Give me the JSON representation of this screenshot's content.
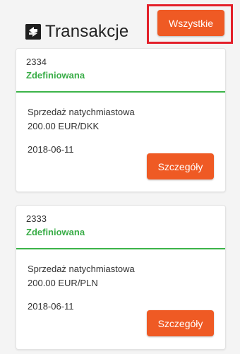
{
  "header": {
    "icon": "transactions-icon",
    "title": "Transakcje",
    "all_button": "Wszystkie"
  },
  "colors": {
    "accent": "#ef5a24",
    "status_green": "#39ad47",
    "highlight_red": "#e3202a"
  },
  "transactions": [
    {
      "id": "2334",
      "status": "Zdefiniowana",
      "type": "Sprzedaż natychmiastowa",
      "amount": "200.00 EUR/DKK",
      "date": "2018-06-11",
      "details_button": "Szczegóły"
    },
    {
      "id": "2333",
      "status": "Zdefiniowana",
      "type": "Sprzedaż natychmiastowa",
      "amount": "200.00 EUR/PLN",
      "date": "2018-06-11",
      "details_button": "Szczegóły"
    }
  ]
}
